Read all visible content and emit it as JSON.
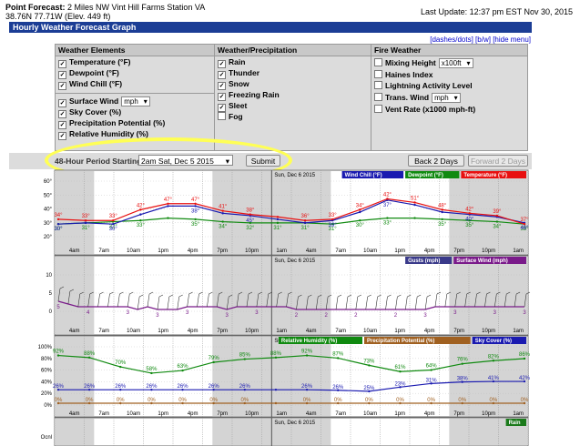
{
  "header": {
    "point_forecast_label": "Point Forecast:",
    "location": "2 Miles NW Vint Hill Farms Station VA",
    "coords": "38.76N 77.71W (Elev. 449 ft)",
    "last_update": "Last Update: 12:37 pm EST Nov 30, 2015"
  },
  "title_bar": "Hourly Weather Forecast Graph",
  "view_links": {
    "dashes": "[dashes/dots]",
    "bw": "[b/w]",
    "hide": "[hide menu]"
  },
  "panel": {
    "weather_elements": {
      "heading": "Weather Elements",
      "items": [
        "Temperature (°F)",
        "Dewpoint (°F)",
        "Wind Chill (°F)",
        "Surface Wind",
        "Sky Cover (%)",
        "Precipitation Potential (%)",
        "Relative Humidity (%)"
      ],
      "wind_unit": "mph"
    },
    "weather_precip": {
      "heading": "Weather/Precipitation",
      "items": [
        "Rain",
        "Thunder",
        "Snow",
        "Freezing Rain",
        "Sleet",
        "Fog"
      ]
    },
    "fire_weather": {
      "heading": "Fire Weather",
      "items": [
        "Mixing Height",
        "Haines Index",
        "Lightning Activity Level",
        "Trans. Wind",
        "Vent Rate (x1000 mph-ft)"
      ],
      "mixing_unit": "x100ft",
      "trans_unit": "mph"
    }
  },
  "period": {
    "label": "48-Hour Period Starting:",
    "selected": "2am Sat, Dec 5 2015",
    "submit": "Submit",
    "back": "Back 2 Days",
    "forward": "Forward 2 Days"
  },
  "graphs": {
    "day_label": "Sun, Dec 6 2015",
    "time_labels": [
      "4am",
      "7am",
      "10am",
      "1pm",
      "4pm",
      "7pm",
      "10pm",
      "1am",
      "4am",
      "7am",
      "10am",
      "1pm",
      "4pm",
      "7pm",
      "10pm",
      "1am"
    ],
    "temp": {
      "legend": [
        "Wind Chill (°F)",
        "Dewpoint (°F)",
        "Temperature (°F)"
      ],
      "yticks": [
        "60°",
        "50°",
        "40°",
        "30°",
        "20°"
      ],
      "temperature": [
        34,
        33,
        33,
        42,
        47,
        47,
        41,
        38,
        36,
        33,
        34,
        42,
        51,
        48,
        42,
        39,
        37,
        30
      ],
      "dewpoint": [
        30,
        31,
        32,
        33,
        35,
        34,
        32,
        31,
        31,
        31,
        30,
        33,
        35,
        35,
        34,
        33,
        32,
        30
      ],
      "windchill": [
        30,
        31,
        30,
        38,
        45,
        45,
        39,
        37,
        34,
        31,
        33,
        40,
        50,
        46,
        40,
        38,
        36,
        31
      ],
      "temp_labels": [
        "34°",
        "33°",
        "33°",
        "42°",
        "47°",
        "47°",
        "41°",
        "38°",
        "36°",
        "33°",
        "34°",
        "42°",
        "51°",
        "48°",
        "42°",
        "39°",
        "37°"
      ],
      "dew_labels": [
        "30°",
        "31°",
        "32°",
        "33°",
        "35°",
        "34°",
        "32°",
        "31°",
        "31°",
        "31°",
        "30°",
        "33°",
        "35°",
        "35°",
        "34°",
        "33°"
      ],
      "wc_labels": [
        "30°",
        "30°",
        "38°",
        "45°",
        "39°",
        "37°",
        "40°",
        "46°"
      ]
    },
    "wind": {
      "legend": [
        "Gusts (mph)",
        "Surface Wind (mph)"
      ],
      "yticks": [
        "10",
        "5",
        "0"
      ],
      "values": [
        5,
        4,
        3,
        3,
        3,
        3,
        3,
        3,
        2,
        3,
        2,
        2,
        2,
        3,
        3,
        3,
        3,
        2,
        3,
        3,
        3,
        3,
        3,
        3,
        2,
        2,
        2,
        2,
        2,
        2,
        2,
        2,
        2,
        2,
        2,
        2,
        2,
        2,
        3,
        3,
        3,
        3,
        3,
        3,
        3,
        3,
        3,
        3
      ],
      "labels": [
        "5",
        "4",
        "3",
        "3",
        "3",
        "3",
        "3",
        "2",
        "2",
        "2",
        "2",
        "3",
        "3",
        "3",
        "3"
      ]
    },
    "humidity": {
      "legend": [
        "Relative Humidity (%)",
        "Precipitation Potential (%)",
        "Sky Cover (%)"
      ],
      "yticks": [
        "100%",
        "80%",
        "60%",
        "40%",
        "20%",
        "0%"
      ],
      "rh": [
        92,
        88,
        70,
        58,
        63,
        79,
        85,
        88,
        92,
        87,
        73,
        61,
        64,
        76,
        82,
        86
      ],
      "sky": [
        26,
        26,
        26,
        26,
        26,
        26,
        26,
        26,
        26,
        25,
        23,
        31,
        38,
        41,
        42,
        42
      ],
      "pop": [
        0,
        0,
        0,
        0,
        0,
        0,
        0,
        0,
        0,
        0,
        0,
        0,
        0,
        0,
        0,
        0
      ],
      "rh_labels": [
        "92%",
        "88%",
        "70%",
        "58%",
        "63%",
        "79%",
        "85%",
        "88%",
        "92%",
        "87%",
        "73%",
        "61%",
        "64%",
        "76%",
        "82%",
        "86%"
      ],
      "sky_labels": [
        "26%",
        "26%",
        "26%",
        "26%",
        "26%",
        "26%",
        "26%",
        "26%",
        "26%",
        "25%",
        "23%",
        "31%",
        "38%",
        "41%",
        "42%"
      ],
      "pop_labels": [
        "0%",
        "0%",
        "0%",
        "0%",
        "0%",
        "0%",
        "0%",
        "0%",
        "0%",
        "0%",
        "0%",
        "0%",
        "0%",
        "0%",
        "0%"
      ]
    },
    "precip": {
      "legend": [
        "Rain"
      ],
      "yticks": [
        "Ocnl"
      ]
    }
  },
  "colors": {
    "temp": "#e81010",
    "dew": "#108a10",
    "windchill": "#1a1ab0",
    "wind": "#7a1a8a",
    "gust": "#3a3a8a",
    "rh": "#108a10",
    "sky": "#1a1ab0",
    "pop": "#a06020",
    "shade": "#d4d4d4",
    "titlebar": "#1b3d95"
  }
}
